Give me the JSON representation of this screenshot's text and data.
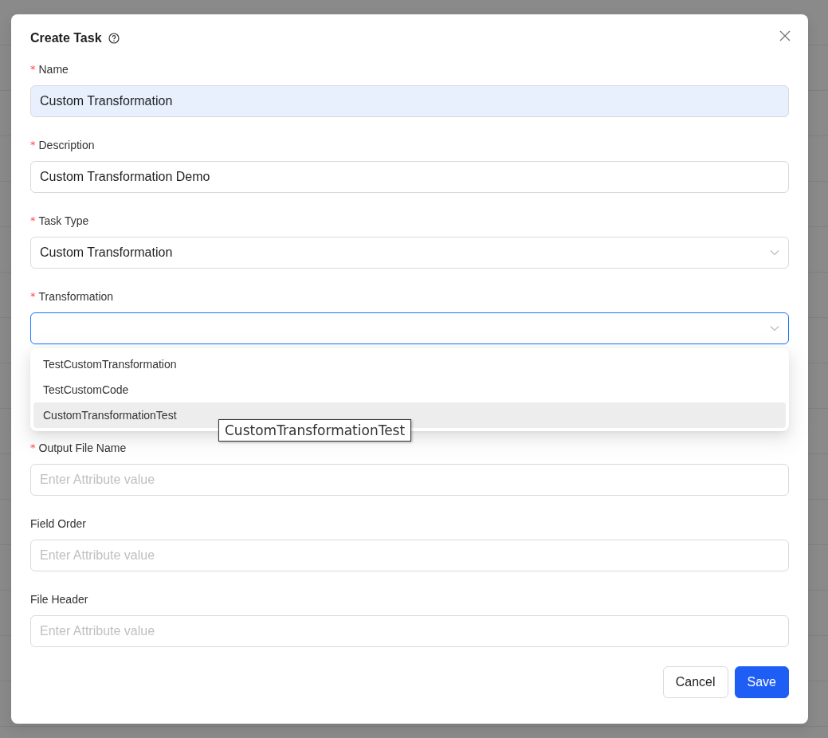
{
  "dialog": {
    "title": "Create Task"
  },
  "fields": [
    {
      "kind": "input",
      "label": "Name",
      "required_mark": "*",
      "value": "Custom Transformation",
      "autofilled": true,
      "focused": false
    },
    {
      "kind": "input",
      "label": "Description",
      "required_mark": "*",
      "value": "Custom Transformation Demo",
      "autofilled": false,
      "focused": false
    },
    {
      "kind": "select",
      "label": "Task Type",
      "required_mark": "*",
      "value": "Custom Transformation",
      "focused": false
    },
    {
      "kind": "select",
      "label": "Transformation",
      "required_mark": "*",
      "focused": true,
      "expanded": true,
      "options": [
        {
          "label": "TestCustomTransformation",
          "selected": false
        },
        {
          "label": "TestCustomCode",
          "selected": false
        },
        {
          "label": "CustomTransformationTest",
          "selected": true
        }
      ],
      "tooltip": "CustomTransformationTest"
    },
    {
      "kind": "input",
      "label": "Output File Name",
      "required_mark": "*",
      "placeholder": "Enter Attribute value",
      "autofilled": false,
      "focused": false
    },
    {
      "kind": "input",
      "label": "Field Order",
      "placeholder": "Enter Attribute value",
      "autofilled": false,
      "focused": false
    },
    {
      "kind": "input",
      "label": "File Header",
      "placeholder": "Enter Attribute value",
      "autofilled": false,
      "focused": false
    }
  ],
  "buttons": [
    {
      "label": "Cancel",
      "kind": "secondary"
    },
    {
      "label": "Save",
      "kind": "primary"
    }
  ]
}
